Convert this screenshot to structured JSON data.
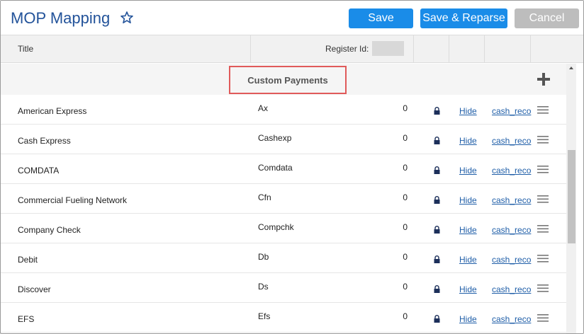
{
  "header": {
    "title": "MOP Mapping",
    "save_label": "Save",
    "save_reparse_label": "Save & Reparse",
    "cancel_label": "Cancel"
  },
  "columns": {
    "title": "Title",
    "register_id": "Register Id:"
  },
  "section": {
    "label": "Custom Payments"
  },
  "rows": [
    {
      "title": "American Express",
      "code": "Ax",
      "count": "0",
      "hide": "Hide",
      "action": "cash_reco"
    },
    {
      "title": "Cash Express",
      "code": "Cashexp",
      "count": "0",
      "hide": "Hide",
      "action": "cash_reco"
    },
    {
      "title": "COMDATA",
      "code": "Comdata",
      "count": "0",
      "hide": "Hide",
      "action": "cash_reco"
    },
    {
      "title": "Commercial Fueling Network",
      "code": "Cfn",
      "count": "0",
      "hide": "Hide",
      "action": "cash_reco"
    },
    {
      "title": "Company Check",
      "code": "Compchk",
      "count": "0",
      "hide": "Hide",
      "action": "cash_reco"
    },
    {
      "title": "Debit",
      "code": "Db",
      "count": "0",
      "hide": "Hide",
      "action": "cash_reco"
    },
    {
      "title": "Discover",
      "code": "Ds",
      "count": "0",
      "hide": "Hide",
      "action": "cash_reco"
    },
    {
      "title": "EFS",
      "code": "Efs",
      "count": "0",
      "hide": "Hide",
      "action": "cash_reco"
    }
  ],
  "colors": {
    "title_blue": "#23539a",
    "primary_button": "#1a8ce8",
    "disabled_button": "#bdbdbd",
    "link_blue": "#1f5ea8",
    "highlight_border": "#e05a5a"
  },
  "icons": {
    "favorite": "star-outline-icon",
    "add": "plus-icon",
    "lock": "lock-icon",
    "drag": "hamburger-menu-icon"
  }
}
